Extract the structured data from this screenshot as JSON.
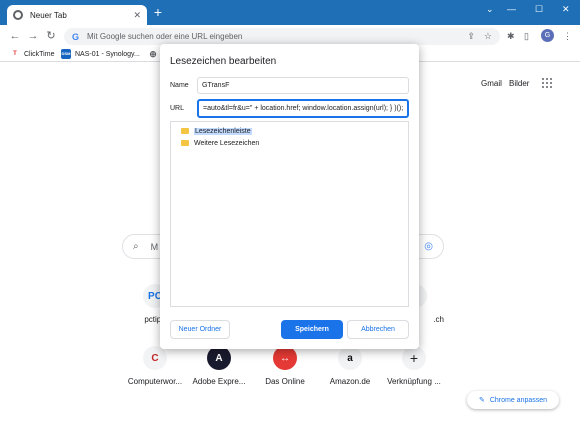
{
  "browser": {
    "tab_title": "Neuer Tab",
    "new_tab_symbol": "+",
    "omnibox_placeholder": "Mit Google suchen oder eine URL eingeben",
    "profile_initial": "G",
    "accent": "#1f6fb7"
  },
  "bookmarks_bar": [
    {
      "label": "ClickTime",
      "icon": "T",
      "color": "#e53935"
    },
    {
      "label": "NAS-01 - Synology...",
      "icon": "DSM",
      "color": "#1565c0"
    },
    {
      "label": "",
      "icon": "globe-icon",
      "color": "#5f6368"
    }
  ],
  "page": {
    "links": [
      "Gmail",
      "Bilder"
    ],
    "search_placeholder": "M",
    "shortcuts_row1": [
      {
        "label": "pctipp",
        "glyph": "PC",
        "color": "#1a73e8"
      },
      {
        "label": ".ch",
        "glyph": "◆",
        "color": "#1a73e8"
      }
    ],
    "shortcuts_row2": [
      {
        "label": "Computerwor...",
        "glyph": "C",
        "color": "#c62828"
      },
      {
        "label": "Adobe Expre...",
        "glyph": "A",
        "color": "#e53935"
      },
      {
        "label": "Das Online",
        "glyph": "↔",
        "color": "#e53935"
      },
      {
        "label": "Amazon.de",
        "glyph": "a",
        "color": "#111111"
      },
      {
        "label": "Verknüpfung ...",
        "glyph": "+",
        "color": "#202124"
      }
    ],
    "customize_label": "Chrome anpassen"
  },
  "dialog": {
    "title": "Lesezeichen bearbeiten",
    "name_label": "Name",
    "name_value": "GTransF",
    "url_label": "URL",
    "url_value": "=auto&tl=fr&u=\" + location.href; window.location.assign(url); } )();",
    "folders": [
      {
        "label": "Lesezeichenleiste",
        "selected": true
      },
      {
        "label": "Weitere Lesezeichen",
        "selected": false
      }
    ],
    "new_folder_label": "Neuer Ordner",
    "save_label": "Speichern",
    "cancel_label": "Abbrechen"
  }
}
